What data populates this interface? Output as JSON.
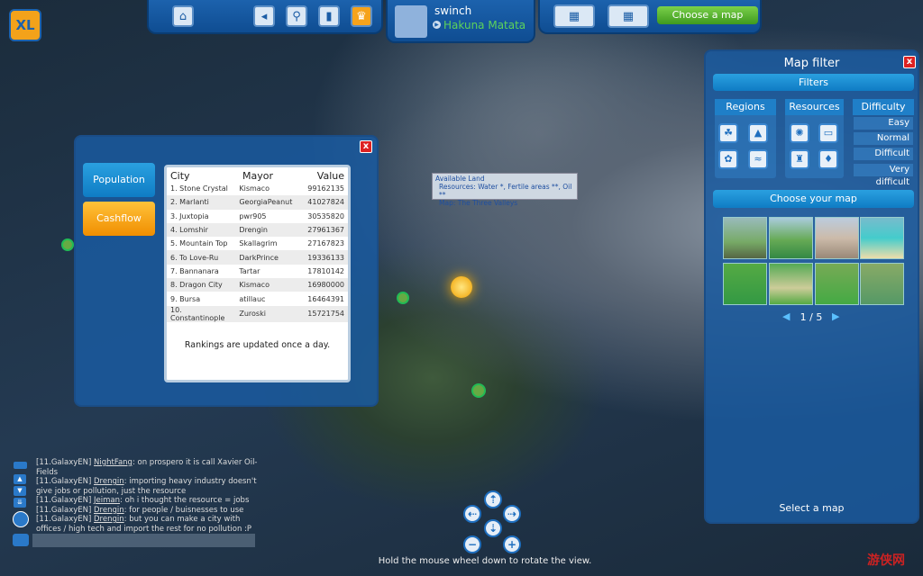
{
  "topbar": {
    "logo": "XL",
    "icons": [
      "city-hall-icon",
      "rotate-arrows-icon",
      "search-icon",
      "chart-icon",
      "trophy-icon"
    ],
    "profile": {
      "username": "swinch",
      "city": "Hakuna Matata"
    },
    "choose_map_label": "Choose a map"
  },
  "rankings": {
    "tabs": [
      {
        "label": "Population"
      },
      {
        "label": "Cashflow"
      }
    ],
    "columns": [
      "City",
      "Mayor",
      "Value"
    ],
    "rows": [
      [
        "1. Stone Crystal",
        "Kismaco",
        "99162135"
      ],
      [
        "2. Marlanti",
        "GeorgiaPeanut",
        "41027824"
      ],
      [
        "3. Juxtopia",
        "pwr905",
        "30535820"
      ],
      [
        "4. Lomshir",
        "Drengin",
        "27961367"
      ],
      [
        "5. Mountain Top",
        "Skallagrim",
        "27167823"
      ],
      [
        "6. To Love-Ru",
        "DarkPrince",
        "19336133"
      ],
      [
        "7. Bannanara",
        "Tartar",
        "17810142"
      ],
      [
        "8. Dragon City",
        "Kismaco",
        "16980000"
      ],
      [
        "9. Bursa",
        "atillauc",
        "16464391"
      ],
      [
        "10. Constantinople",
        "Zuroski",
        "15721754"
      ]
    ],
    "footer": "Rankings are updated once a day.",
    "close": "x"
  },
  "tooltip": {
    "title": "Available Land",
    "resources": "Resources: Water *, Fertile areas **, Oil **",
    "map": "Map: The Three Valleys"
  },
  "map_filter": {
    "title": "Map filter",
    "close": "x",
    "filters_label": "Filters",
    "regions_label": "Regions",
    "resources_label": "Resources",
    "difficulty_label": "Difficulty",
    "difficulty_options": [
      "Easy",
      "Normal",
      "Difficult",
      "Very difficult"
    ],
    "choose_label": "Choose your map",
    "page": "1 / 5",
    "status": "Select a map"
  },
  "chat": {
    "messages": [
      {
        "channel": "[11.GalaxyEN]",
        "user": "NightFang",
        "text": ": on prospero it is call Xavier Oil-Fields"
      },
      {
        "channel": "[11.GalaxyEN]",
        "user": "Drengin",
        "text": ": importing heavy industry doesn't give jobs or pollution, just the resource"
      },
      {
        "channel": "[11.GalaxyEN]",
        "user": "Jeiman",
        "text": ": oh i thought the resource = jobs"
      },
      {
        "channel": "[11.GalaxyEN]",
        "user": "Drengin",
        "text": ": for people / buisnesses to use"
      },
      {
        "channel": "[11.GalaxyEN]",
        "user": "Drengin",
        "text": ": but you can make a city with offices / high tech and import the rest for no pollution :P"
      }
    ],
    "input_placeholder": ""
  },
  "hint": "Hold the mouse wheel down to rotate the view.",
  "watermark": "游侠网"
}
